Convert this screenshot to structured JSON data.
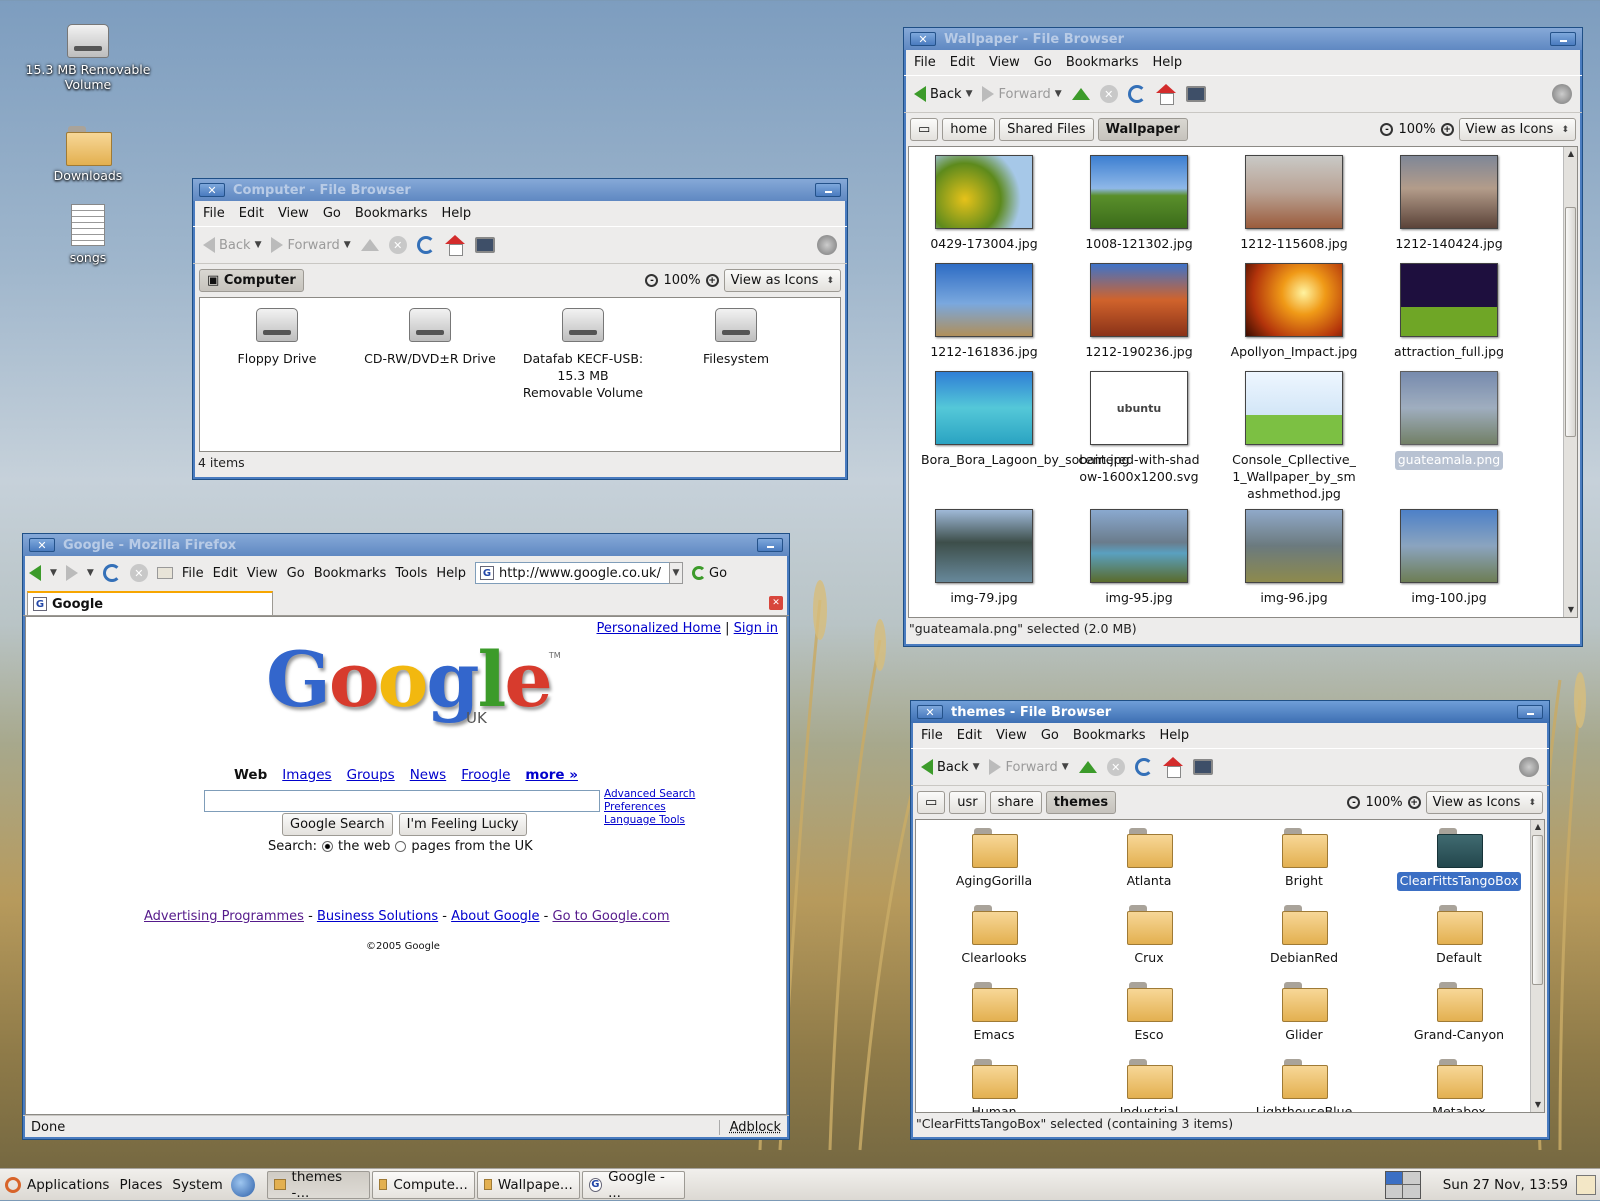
{
  "desktop": {
    "icons": [
      {
        "label": "15.3 MB Removable Volume",
        "icon": "removable-drive-icon"
      },
      {
        "label": "Downloads",
        "icon": "folder-icon"
      },
      {
        "label": "songs",
        "icon": "text-document-icon"
      }
    ]
  },
  "menus": {
    "file": "File",
    "edit": "Edit",
    "view": "View",
    "go": "Go",
    "bookmarks": "Bookmarks",
    "help": "Help",
    "tools": "Tools"
  },
  "toolbar": {
    "back": "Back",
    "forward": "Forward",
    "zoom": "100%",
    "view_as": "View as Icons"
  },
  "computer_window": {
    "title": "Computer - File Browser",
    "path": [
      "Computer"
    ],
    "items": [
      "Floppy Drive",
      "CD-RW/DVD±R Drive",
      "Datafab KECF-USB: 15.3 MB Removable Volume",
      "Filesystem"
    ],
    "status": "4 items"
  },
  "wallpaper_window": {
    "title": "Wallpaper - File Browser",
    "path": [
      "home",
      "Shared Files",
      "Wallpaper"
    ],
    "items": [
      "0429-173004.jpg",
      "1008-121302.jpg",
      "1212-115608.jpg",
      "1212-140424.jpg",
      "1212-161836.jpg",
      "1212-190236.jpg",
      "Apollyon_Impact.jpg",
      "attraction_full.jpg",
      "Bora_Bora_Lagoon_by_sobain.jpg",
      "centered-with-shadow-1600x1200.svg",
      "Console_Cpllective_1_Wallpaper_by_smashmethod.jpg",
      "guateamala.png",
      "img-79.jpg",
      "img-95.jpg",
      "img-96.jpg",
      "img-100.jpg"
    ],
    "ubuntu_text": "ubuntu",
    "status": "\"guateamala.png\" selected (2.0 MB)"
  },
  "themes_window": {
    "title": "themes - File Browser",
    "path": [
      "usr",
      "share",
      "themes"
    ],
    "items": [
      "AgingGorilla",
      "Atlanta",
      "Bright",
      "ClearFittsTangoBox",
      "Clearlooks",
      "Crux",
      "DebianRed",
      "Default",
      "Emacs",
      "Esco",
      "Glider",
      "Grand-Canyon",
      "Human",
      "Industrial",
      "LighthouseBlue",
      "Metabox"
    ],
    "status": "\"ClearFittsTangoBox\" selected (containing 3 items)"
  },
  "firefox_window": {
    "title": "Google - Mozilla Firefox",
    "url": "http://www.google.co.uk/",
    "go": "Go",
    "tab_label": "Google",
    "status": "Done",
    "adblock": "Adblock"
  },
  "google_page": {
    "top_links": [
      "Personalized Home",
      "Sign in"
    ],
    "logo_letters": [
      "G",
      "o",
      "o",
      "g",
      "l",
      "e"
    ],
    "logo_colors": [
      "#3366cc",
      "#d73b2d",
      "#f2b80f",
      "#3366cc",
      "#3c9b2a",
      "#d73b2d"
    ],
    "logo_tm": "TM",
    "logo_sub": "UK",
    "nav_active": "Web",
    "nav_links": [
      "Images",
      "Groups",
      "News",
      "Froogle"
    ],
    "nav_more": "more »",
    "side_links": [
      "Advanced Search",
      "Preferences",
      "Language Tools"
    ],
    "search_button": "Google Search",
    "lucky_button": "I'm Feeling Lucky",
    "search_label": "Search:",
    "radio_web": "the web",
    "radio_uk": "pages from the UK",
    "footer_links": [
      "Advertising Programmes",
      "Business Solutions",
      "About Google",
      "Go to Google.com"
    ],
    "copyright": "©2005 Google"
  },
  "taskbar": {
    "menus": [
      "Applications",
      "Places",
      "System"
    ],
    "tasks": [
      "themes -...",
      "Compute...",
      "Wallpape...",
      "Google - ..."
    ],
    "clock": "Sun 27 Nov, 13:59"
  },
  "colors": {
    "title_active": "#3d6fb3",
    "selection": "#3b6fc4",
    "link": "#0000cc"
  }
}
